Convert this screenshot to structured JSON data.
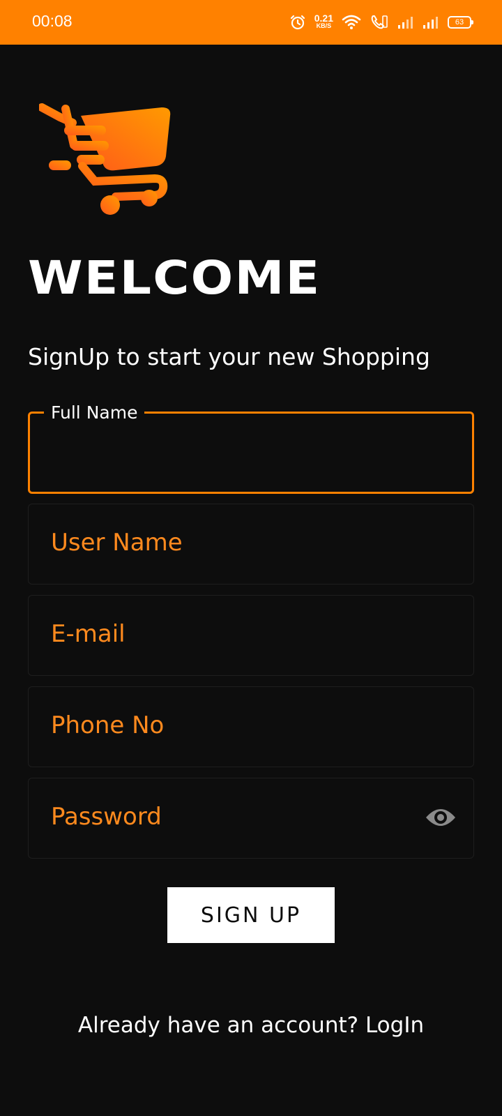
{
  "status_bar": {
    "time": "00:08",
    "net_speed_value": "0.21",
    "net_speed_unit": "KB/S",
    "battery": "63",
    "icons": [
      "alarm-icon",
      "wifi-icon",
      "volte-call-icon",
      "signal-icon",
      "signal-icon",
      "battery-icon"
    ]
  },
  "logo": {
    "icon": "shopping-cart-icon",
    "color": "#ff8100"
  },
  "header": {
    "title": "WELCOME",
    "subtitle": "SignUp to start your new Shopping"
  },
  "form": {
    "full_name_label": "Full Name",
    "username_placeholder": "User Name",
    "email_placeholder": "E-mail",
    "phone_placeholder": "Phone No",
    "password_placeholder": "Password",
    "password_toggle_icon": "eye-icon",
    "submit_label": "SIGN UP"
  },
  "footer": {
    "login_prompt": "Already have an account? LogIn"
  },
  "colors": {
    "accent": "#ff8100",
    "background": "#0d0d0d",
    "placeholder": "#ff8a1e",
    "text": "#ffffff"
  }
}
